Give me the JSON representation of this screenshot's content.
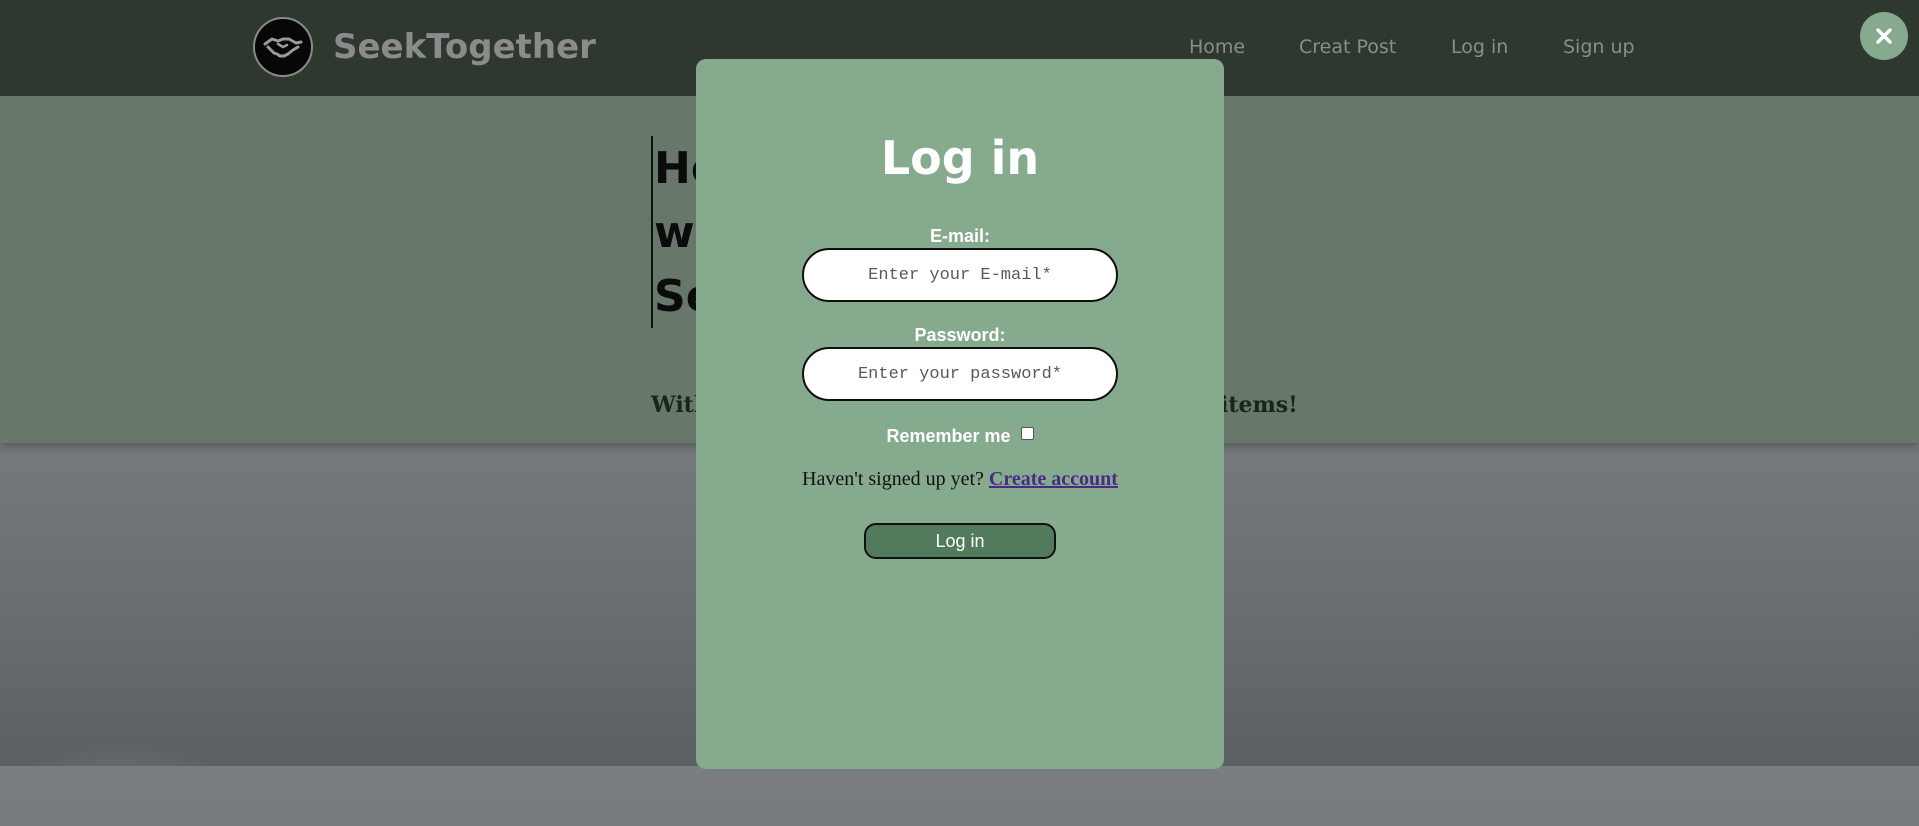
{
  "header": {
    "brand": "SeekTogether",
    "nav": [
      "Home",
      "Creat Post",
      "Log in",
      "Sign up"
    ]
  },
  "hero": {
    "title_lines": [
      "He",
      "wi",
      "Se"
    ],
    "subtitle_left": "With",
    "subtitle_right": "items!"
  },
  "modal": {
    "title": "Log in",
    "email_label": "E-mail:",
    "email_placeholder": "Enter your E-mail*",
    "password_label": "Password:",
    "password_placeholder": "Enter your password*",
    "remember_label": "Remember me",
    "remember_checked": false,
    "signup_prompt": "Haven't signed up yet?",
    "signup_link": "Create account",
    "submit_label": "Log in",
    "close_symbol": "×"
  },
  "colors": {
    "nav_bg": "#2e382f",
    "hero_bg": "#67786a",
    "modal_bg": "#86aa8e",
    "button_bg": "#527a5c",
    "link": "#4a2a86"
  },
  "icons": {
    "logo": "handshake-icon",
    "close": "close-icon"
  }
}
